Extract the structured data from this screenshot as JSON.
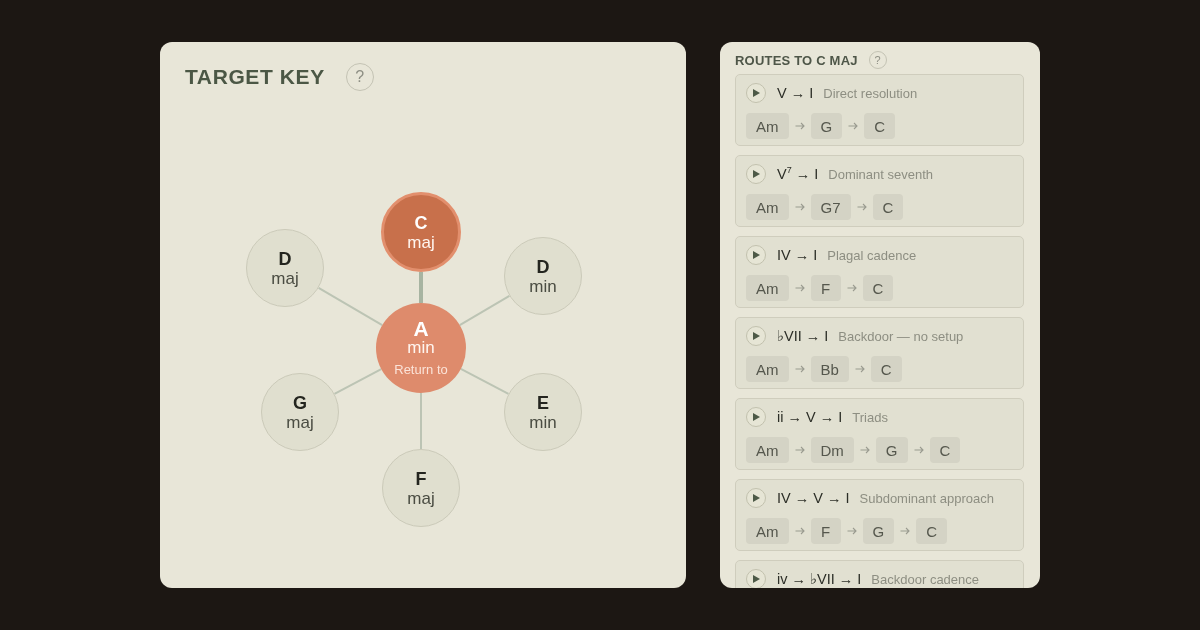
{
  "target_key": {
    "title": "TARGET KEY",
    "help": "?",
    "center": {
      "root": "A",
      "quality": "min",
      "caption": "Return to"
    },
    "neighbors": [
      {
        "root": "C",
        "quality": "maj",
        "selected": true
      },
      {
        "root": "D",
        "quality": "min",
        "selected": false
      },
      {
        "root": "E",
        "quality": "min",
        "selected": false
      },
      {
        "root": "F",
        "quality": "maj",
        "selected": false
      },
      {
        "root": "G",
        "quality": "maj",
        "selected": false
      },
      {
        "root": "D",
        "quality": "maj",
        "selected": false
      }
    ]
  },
  "routes_panel": {
    "title": "ROUTES TO C MAJ",
    "help": "?",
    "routes": [
      {
        "numerals": "V → I",
        "description": "Direct resolution",
        "chords": [
          "Am",
          "G",
          "C"
        ]
      },
      {
        "numerals": "V$^{7}$ → I",
        "description": "Dominant seventh",
        "chords": [
          "Am",
          "G7",
          "C"
        ]
      },
      {
        "numerals": "IV → I",
        "description": "Plagal cadence",
        "chords": [
          "Am",
          "F",
          "C"
        ]
      },
      {
        "numerals": "♭VII → I",
        "description": "Backdoor — no setup",
        "chords": [
          "Am",
          "Bb",
          "C"
        ]
      },
      {
        "numerals": "ii → V → I",
        "description": "Triads",
        "chords": [
          "Am",
          "Dm",
          "G",
          "C"
        ]
      },
      {
        "numerals": "IV → V → I",
        "description": "Subdominant approach",
        "chords": [
          "Am",
          "F",
          "G",
          "C"
        ]
      },
      {
        "numerals": "iv → ♭VII → I",
        "description": "Backdoor cadence"
      }
    ]
  }
}
